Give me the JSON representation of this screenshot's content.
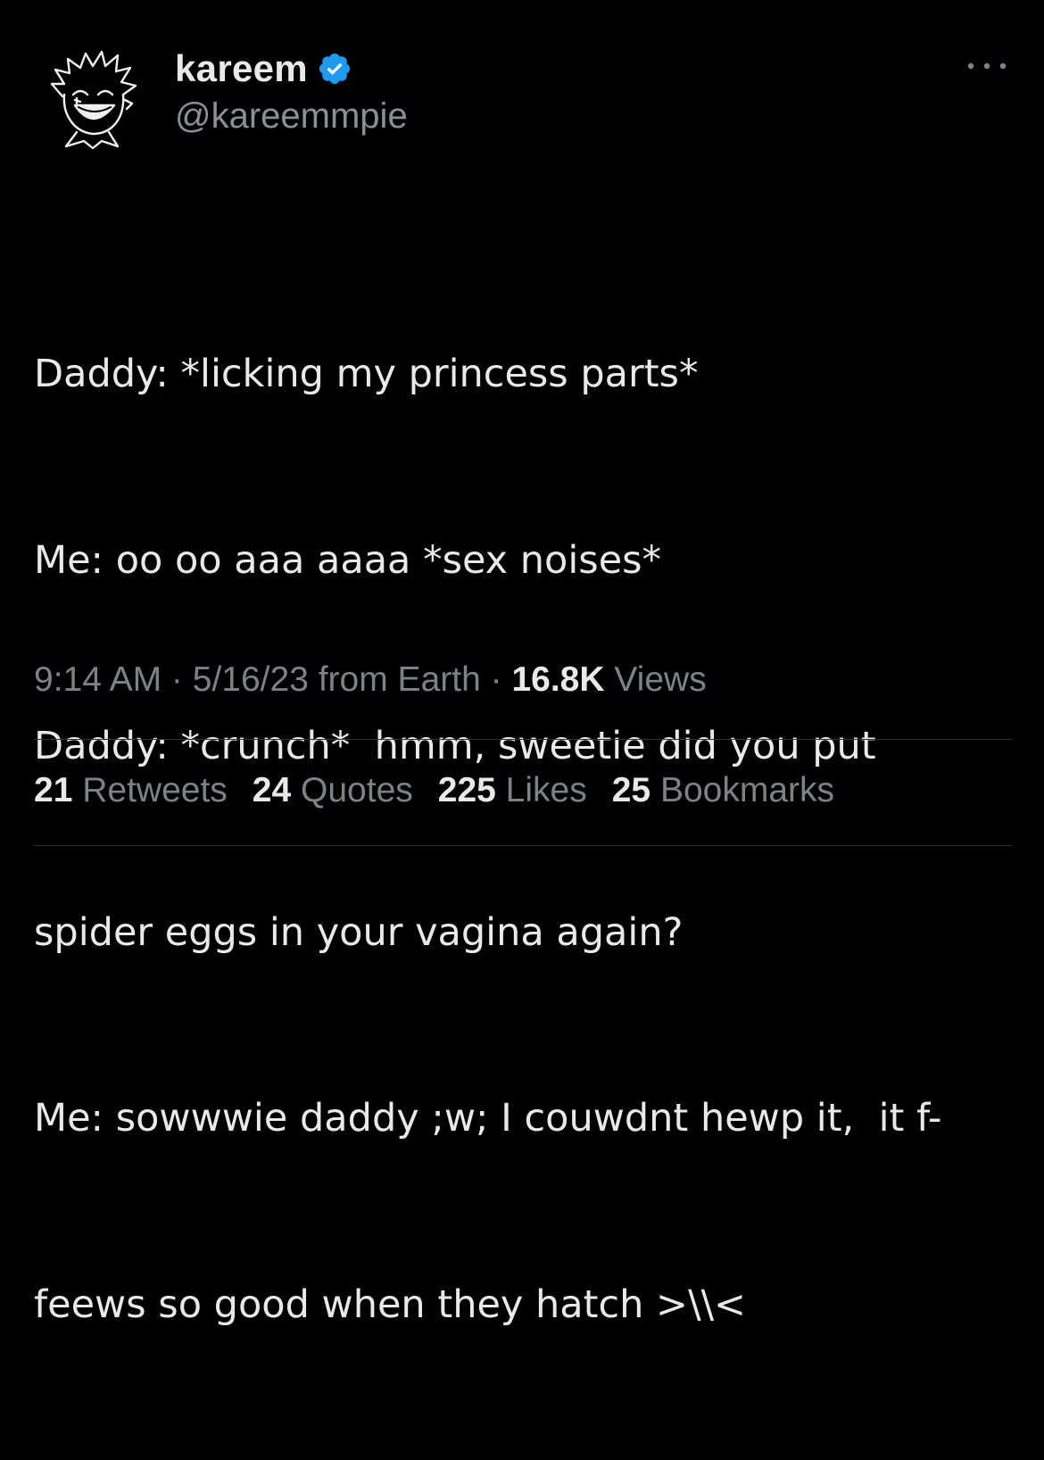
{
  "author": {
    "display_name": "kareem",
    "handle": "@kareemmpie",
    "verified_badge_icon": "verified-badge-icon",
    "avatar_icon": "cartoon-avatar"
  },
  "tweet": {
    "text_lines": [
      "Daddy: *licking my princess parts*",
      "Me: oo oo aaa aaaa *sex noises*",
      "Daddy: *crunch*  hmm, sweetie did you put",
      "spider eggs in your vagina again?",
      "Me: sowwwie daddy ;w; I couwdnt hewp it,  it f-",
      "feews so good when they hatch >\\\\<"
    ]
  },
  "meta": {
    "time": "9:14 AM",
    "sep1": " · ",
    "date": "5/16/23",
    "location": " from Earth",
    "sep2": " · ",
    "views_count": "16.8K",
    "views_label": " Views"
  },
  "stats": [
    {
      "count": "21",
      "label": " Retweets"
    },
    {
      "count": "24",
      "label": " Quotes"
    },
    {
      "count": "225",
      "label": " Likes"
    },
    {
      "count": "25",
      "label": " Bookmarks"
    }
  ],
  "colors": {
    "background": "#000000",
    "text": "#e7e9ea",
    "secondary": "#7d8287",
    "verified": "#1d9bf0",
    "divider": "#2f3336"
  }
}
